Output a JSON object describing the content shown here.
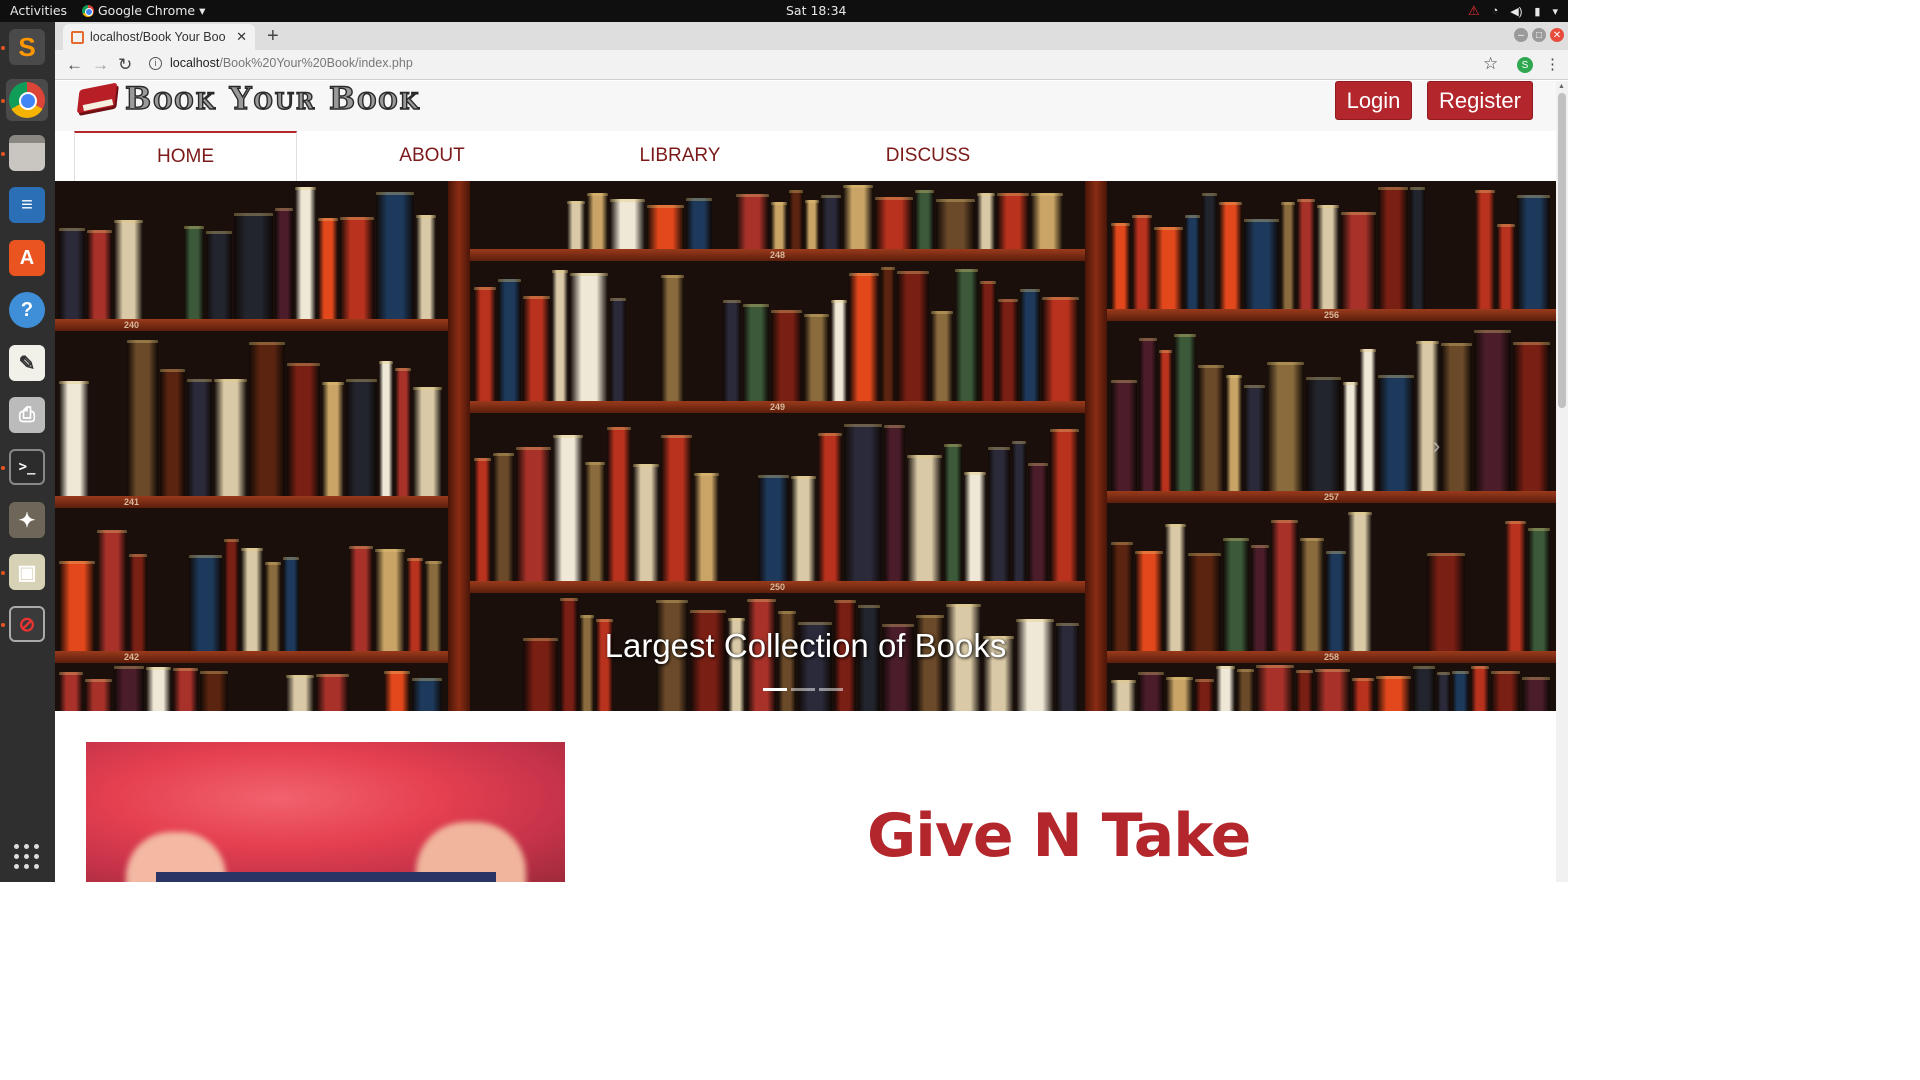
{
  "topbar": {
    "activities": "Activities",
    "app_name": "Google Chrome",
    "clock": "Sat 18:34"
  },
  "browser": {
    "tab_title": "localhost/Book Your Boo",
    "url_host": "localhost",
    "url_path": "/Book%20Your%20Book/index.php",
    "profile_initial": "S"
  },
  "site": {
    "logo_text": "Book Your Book",
    "login_label": "Login",
    "register_label": "Register",
    "nav": [
      {
        "label": "HOME",
        "active": true
      },
      {
        "label": "ABOUT",
        "active": false
      },
      {
        "label": "LIBRARY",
        "active": false
      },
      {
        "label": "DISCUSS",
        "active": false
      }
    ],
    "carousel": {
      "caption": "Largest Collection of Books",
      "shelf_labels": [
        "240",
        "241",
        "242",
        "248",
        "249",
        "250",
        "256",
        "257",
        "258"
      ],
      "slide_count": 3,
      "active_slide": 1
    },
    "section_heading": "Give N Take",
    "accent_color": "#b3262b"
  }
}
